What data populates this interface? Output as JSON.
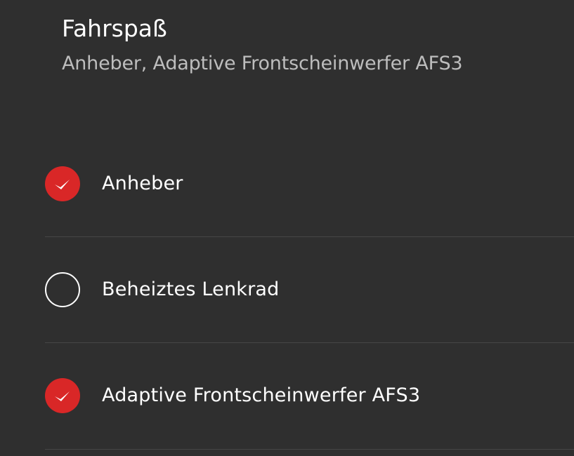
{
  "header": {
    "title": "Fahrspaß",
    "subtitle": "Anheber, Adaptive Frontscheinwerfer AFS3"
  },
  "options": [
    {
      "label": "Anheber",
      "checked": true,
      "icon": "check-icon"
    },
    {
      "label": "Beheiztes Lenkrad",
      "checked": false,
      "icon": ""
    },
    {
      "label": "Adaptive Frontscheinwerfer AFS3",
      "checked": true,
      "icon": "check-icon"
    }
  ],
  "colors": {
    "background": "#2f2f2f",
    "accent": "#d92727",
    "subtitle": "#bdbdbd",
    "divider": "#464646"
  }
}
